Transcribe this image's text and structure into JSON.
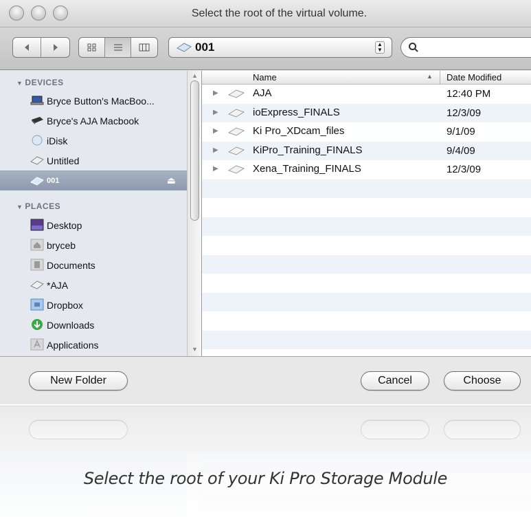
{
  "window": {
    "title": "Select the root of the virtual volume."
  },
  "toolbar": {
    "back_icon": "back-arrow",
    "forward_icon": "forward-arrow",
    "view_icons": [
      "icon-view",
      "list-view",
      "column-view"
    ],
    "location": "001",
    "search_placeholder": ""
  },
  "sidebar": {
    "devices_header": "DEVICES",
    "places_header": "PLACES",
    "devices": [
      {
        "label": "Bryce Button's MacBoo...",
        "icon": "laptop-icon"
      },
      {
        "label": "Bryce's AJA Macbook",
        "icon": "hard-drive-icon"
      },
      {
        "label": "iDisk",
        "icon": "idisk-icon"
      },
      {
        "label": "Untitled",
        "icon": "volume-icon"
      },
      {
        "label": "001",
        "icon": "volume-icon",
        "selected": true
      }
    ],
    "places": [
      {
        "label": "Desktop",
        "icon": "desktop-icon"
      },
      {
        "label": "bryceb",
        "icon": "home-icon"
      },
      {
        "label": "Documents",
        "icon": "documents-icon"
      },
      {
        "label": "*AJA",
        "icon": "volume-icon"
      },
      {
        "label": "Dropbox",
        "icon": "dropbox-icon"
      },
      {
        "label": "Downloads",
        "icon": "downloads-icon"
      },
      {
        "label": "Applications",
        "icon": "applications-icon"
      }
    ]
  },
  "filelist": {
    "columns": {
      "name": "Name",
      "date": "Date Modified"
    },
    "rows": [
      {
        "name": "AJA",
        "date": "12:40 PM"
      },
      {
        "name": "ioExpress_FINALS",
        "date": "12/3/09"
      },
      {
        "name": "Ki Pro_XDcam_files",
        "date": "9/1/09"
      },
      {
        "name": "KiPro_Training_FINALS",
        "date": "9/4/09"
      },
      {
        "name": "Xena_Training_FINALS",
        "date": "12/3/09"
      }
    ]
  },
  "buttons": {
    "new_folder": "New Folder",
    "cancel": "Cancel",
    "choose": "Choose"
  },
  "caption": "Select the root of your Ki Pro Storage Module",
  "colors": {
    "sidebar_bg": "#e5e9ef",
    "selection": "#8d99ad",
    "row_alt": "#eef2f9"
  }
}
